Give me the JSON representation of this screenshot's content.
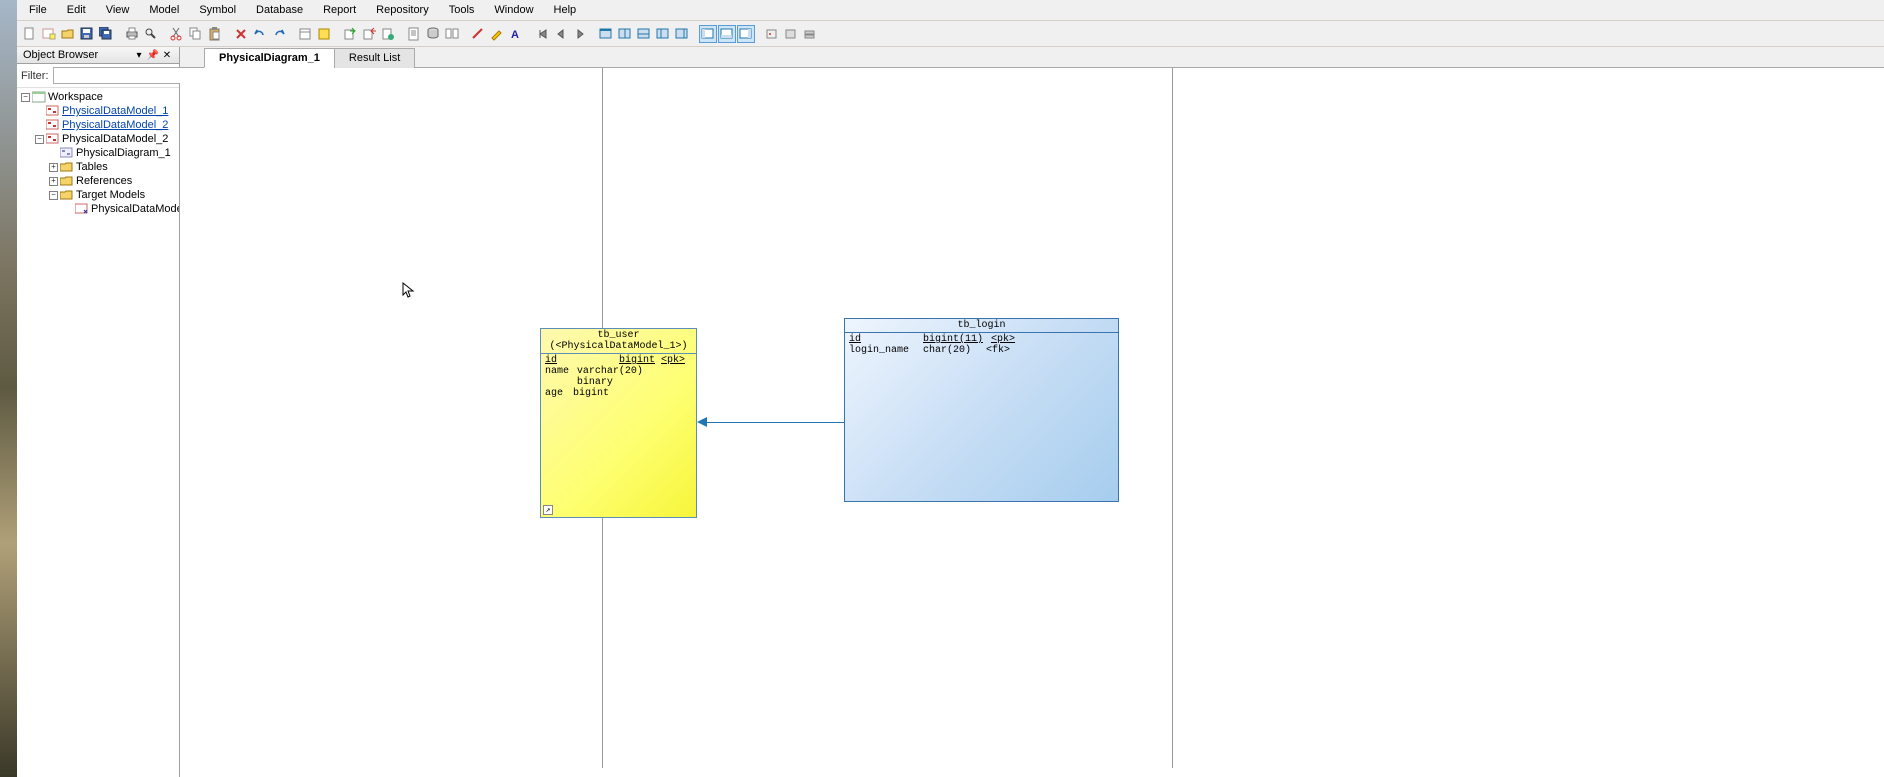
{
  "menu": {
    "items": [
      "File",
      "Edit",
      "View",
      "Model",
      "Symbol",
      "Database",
      "Report",
      "Repository",
      "Tools",
      "Window",
      "Help"
    ]
  },
  "sidebar": {
    "title": "Object Browser",
    "filter_label": "Filter:",
    "filter_value": "",
    "tree": {
      "root": "Workspace",
      "items": [
        {
          "label": "PhysicalDataModel_1",
          "link": true
        },
        {
          "label": "PhysicalDataModel_2",
          "link": true
        },
        {
          "label": "PhysicalDataModel_2",
          "link": false,
          "expanded": true,
          "children": [
            {
              "label": "PhysicalDiagram_1"
            },
            {
              "label": "Tables",
              "expandable": true
            },
            {
              "label": "References",
              "expandable": true
            },
            {
              "label": "Target Models",
              "expandable": true,
              "expanded": true,
              "children": [
                {
                  "label": "PhysicalDataModel_"
                }
              ]
            }
          ]
        }
      ]
    }
  },
  "tabs": [
    {
      "label": "PhysicalDiagram_1",
      "active": true
    },
    {
      "label": "Result List",
      "active": false
    }
  ],
  "diagram": {
    "entity1": {
      "title": "tb_user",
      "subtitle": "(<PhysicalDataModel_1>)",
      "rows": [
        {
          "name": "id",
          "type": "bigint",
          "key": "<pk>",
          "underline": true
        },
        {
          "name": "name",
          "type": "varchar(20) binary",
          "key": ""
        },
        {
          "name": "age",
          "type": "bigint",
          "key": ""
        }
      ]
    },
    "entity2": {
      "title": "tb_login",
      "rows": [
        {
          "name": "id",
          "type": "bigint(11)",
          "key": "<pk>",
          "underline": true
        },
        {
          "name": "login_name",
          "type": "char(20)",
          "key": "<fk>"
        }
      ]
    }
  }
}
